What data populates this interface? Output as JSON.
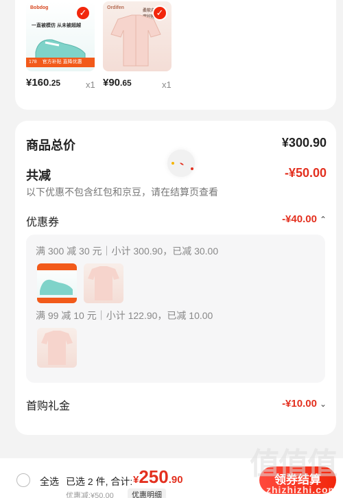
{
  "products": [
    {
      "brand": "Bobdog",
      "promo_text": "一直被模仿 从未被超越",
      "promo_badge": "178",
      "promo_strip": "官方补贴 直降优惠",
      "price_int": "¥160",
      "price_dec": ".25",
      "qty": "x1",
      "thumb_icon": "shoe-icon"
    },
    {
      "brand": "Ordifen",
      "promo_text": "柔软亲肤 深度好睡眠",
      "price_int": "¥90",
      "price_dec": ".65",
      "qty": "x1",
      "thumb_icon": "pajama-icon"
    }
  ],
  "summary": {
    "goods_total_label": "商品总价",
    "goods_total_value": "¥300.90",
    "reduction_label": "共减",
    "reduction_value": "-¥50.00",
    "note": "以下优惠不包含红包和京豆，请在结算页查看",
    "coupon_label": "优惠券",
    "coupon_value": "-¥40.00",
    "rules": [
      "满 300 减 30 元｜小计 300.90，已减 30.00",
      "满 99 减 10 元｜小计 122.90，已减 10.00"
    ],
    "gift_label": "首购礼金",
    "gift_value": "-¥10.00"
  },
  "bottom": {
    "select_all": "全选",
    "selected_summary": "已选 2 件, 合计:",
    "total_currency": "¥",
    "total_int": "250",
    "total_dec": ".90",
    "discount_line": "优惠减:¥50.00",
    "detail_button": "优惠明细",
    "checkout_button": "领券结算",
    "watermark_big": "值值值",
    "watermark_url": "zhizhizhi.com"
  },
  "colors": {
    "accent_red": "#e3301f",
    "checkout_red": "#f2270c",
    "background": "#f3f3f3"
  }
}
